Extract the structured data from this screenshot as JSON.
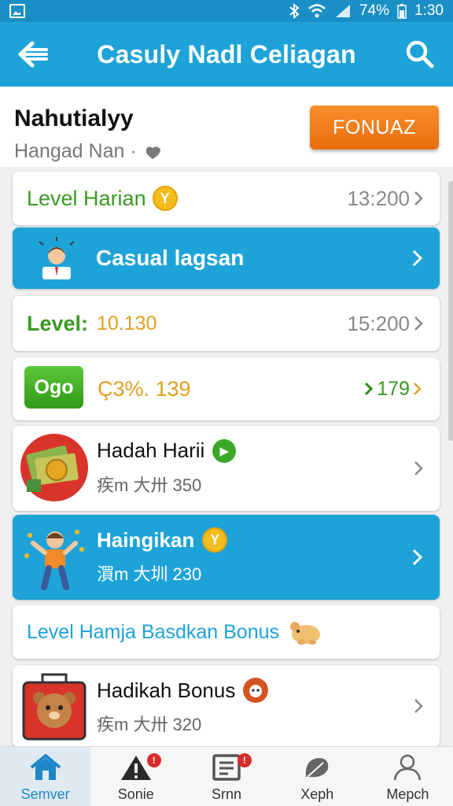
{
  "status_bar": {
    "battery": "74%",
    "time": "1:30"
  },
  "app_bar": {
    "title": "Casuly Nadl Celiagan"
  },
  "header": {
    "name": "Nahutialyy",
    "subtitle": "Hangad Nan ·",
    "action_button": "FONUAZ"
  },
  "rows": {
    "level_harian": {
      "label": "Level Harian",
      "coin": "Y",
      "value": "13:200"
    },
    "casual": {
      "label": "Casual lagsan"
    },
    "level": {
      "label": "Level:",
      "value_left": "10.130",
      "value_right": "15:200"
    },
    "ogo": {
      "badge": "Ogo",
      "amount": "Ç3%. 139",
      "right_value": "179"
    },
    "hadah": {
      "title": "Hadah Harii",
      "subtitle": "疾m 大卅 350"
    },
    "haingikan": {
      "title": "Haingikan",
      "coin": "Y",
      "subtitle": "㵋m 大圳 230"
    },
    "level_hamja": {
      "label": "Level Hamja Basdkan Bonus"
    },
    "hadikah": {
      "title": "Hadikah Bonus",
      "subtitle": "疾m 大卅 320"
    }
  },
  "bottom_nav": [
    {
      "label": "Semver",
      "icon": "home-icon",
      "active": true
    },
    {
      "label": "Sonie",
      "icon": "warning-icon",
      "badge": "!"
    },
    {
      "label": "Srnn",
      "icon": "document-icon",
      "badge": "!"
    },
    {
      "label": "Xeph",
      "icon": "leaf-icon"
    },
    {
      "label": "Mepch",
      "icon": "user-icon"
    }
  ],
  "colors": {
    "primary": "#1ea3d8",
    "accent": "#f3821f",
    "green": "#3a9a22",
    "gold": "#e0a020"
  }
}
